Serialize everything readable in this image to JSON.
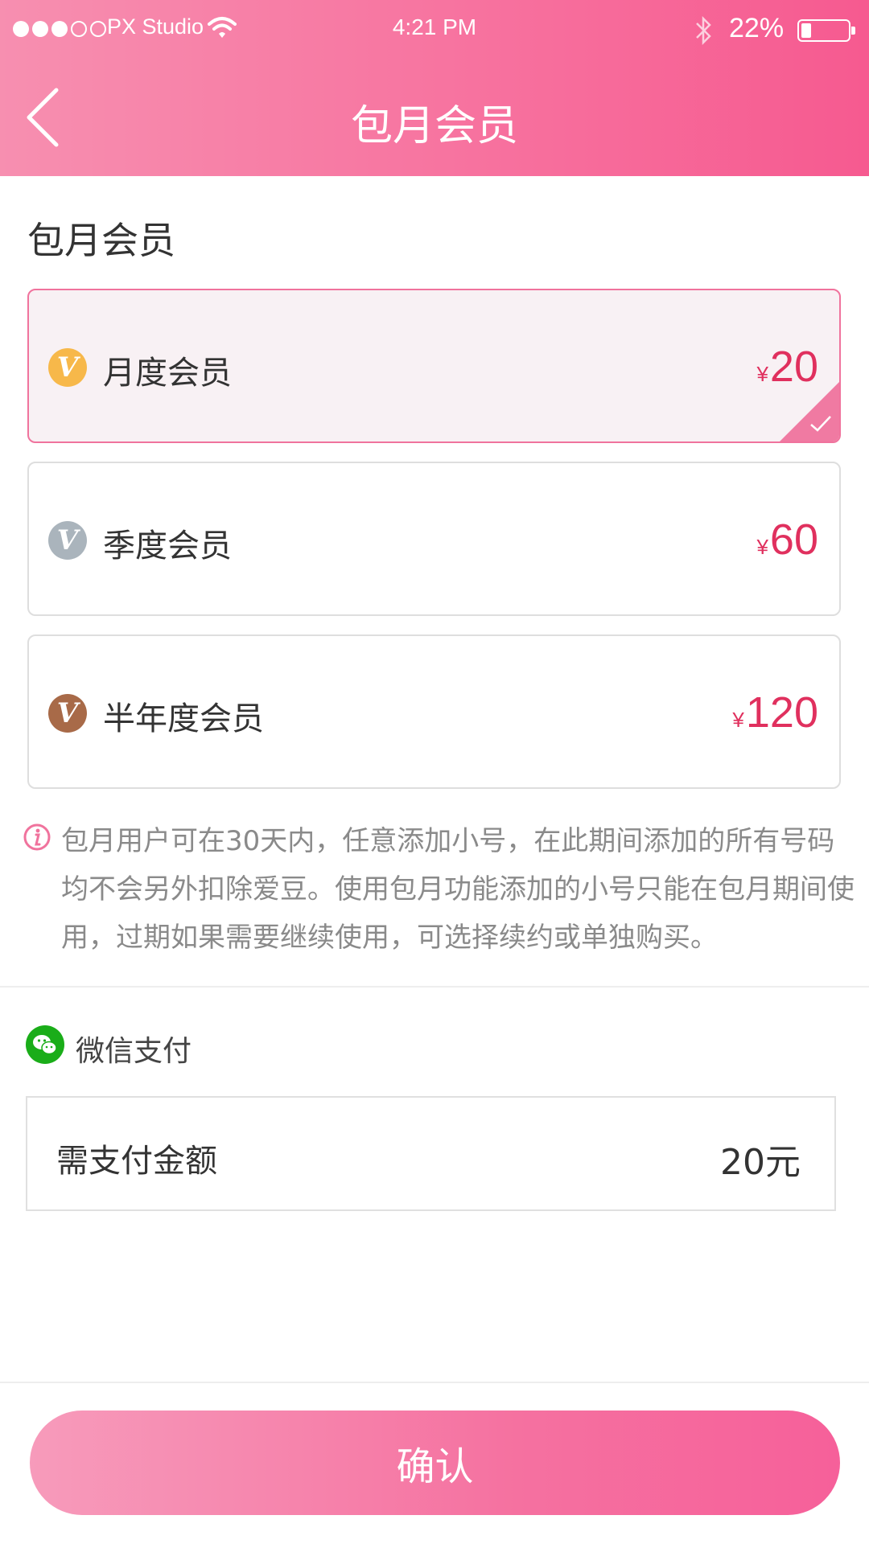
{
  "status_bar": {
    "carrier": "PX Studio",
    "time": "4:21 PM",
    "battery_percent": "22%",
    "signal_bars_filled": 3,
    "signal_bars_total": 5,
    "battery_level": 0.22
  },
  "nav": {
    "title": "包月会员",
    "back_icon": "chevron-left-icon"
  },
  "section": {
    "title": "包月会员"
  },
  "plans": [
    {
      "name": "月度会员",
      "currency": "¥",
      "price": "20",
      "badge_letter": "V",
      "badge_color": "#f7b84a",
      "selected": true
    },
    {
      "name": "季度会员",
      "currency": "¥",
      "price": "60",
      "badge_letter": "V",
      "badge_color": "#aab4bc",
      "selected": false
    },
    {
      "name": "半年度会员",
      "currency": "¥",
      "price": "120",
      "badge_letter": "V",
      "badge_color": "#a86a48",
      "selected": false
    }
  ],
  "notice": {
    "icon": "info-icon",
    "text": "包月用户可在30天内，任意添加小号，在此期间添加的所有号码均不会另外扣除爱豆。使用包月功能添加的小号只能在包月期间使用，过期如果需要继续使用，可选择续约或单独购买。"
  },
  "payment": {
    "method_icon": "wechat-icon",
    "method_label": "微信支付",
    "amount_label": "需支付金额",
    "amount_value": "20元"
  },
  "confirm": {
    "label": "确认"
  },
  "colors": {
    "accent": "#f76a9a",
    "price": "#e0305e",
    "wechat": "#1aad19"
  }
}
